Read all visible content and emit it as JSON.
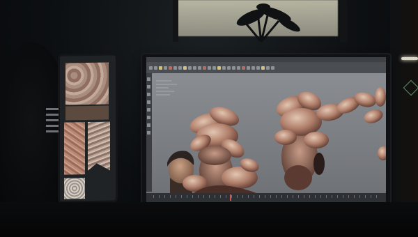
{
  "scene": {
    "description_kind": "photo",
    "colors": {
      "background": "#0b0d0f",
      "viewport": "#7a7d81",
      "fungus_light": "#d6b7a2",
      "fungus_dark": "#6a3f35",
      "skin": "#a8826a"
    }
  }
}
